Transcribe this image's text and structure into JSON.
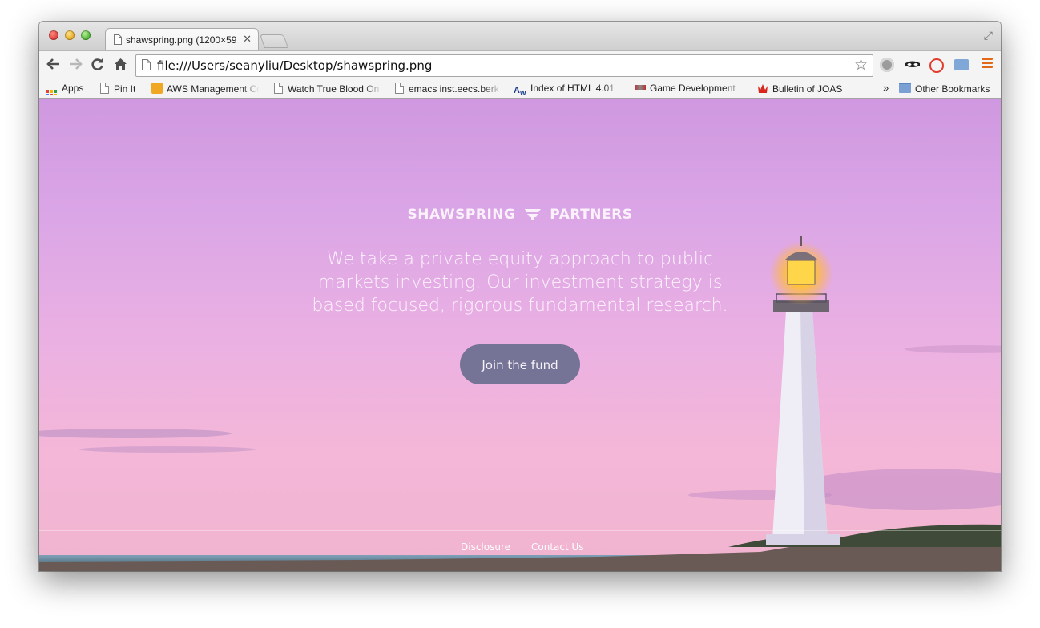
{
  "browser": {
    "tab_title": "shawspring.png (1200×59",
    "url": "file:///Users/seanyliu/Desktop/shawspring.png"
  },
  "bookmarks": {
    "items": [
      {
        "label": "Apps",
        "icon": "apps-grid-icon"
      },
      {
        "label": "Pin It",
        "icon": "document-icon"
      },
      {
        "label": "AWS Management Co",
        "icon": "aws-cube-icon"
      },
      {
        "label": "Watch True Blood On",
        "icon": "document-icon"
      },
      {
        "label": "emacs inst.eecs.berk",
        "icon": "document-icon"
      },
      {
        "label": "Index of HTML 4.01",
        "icon": "w3c-icon"
      },
      {
        "label": "Game Development",
        "icon": "gamedev-icon"
      },
      {
        "label": "Bulletin of JOAS",
        "icon": "crown-icon"
      }
    ],
    "overflow": "»",
    "other": "Other Bookmarks"
  },
  "page": {
    "brand_left": "SHAWSPRING",
    "brand_right": "PARTNERS",
    "tagline": "We take a private equity approach to public markets investing. Our investment strategy is based focused, rigorous fundamental research.",
    "cta": "Join the fund",
    "footer": {
      "disclosure": "Disclosure",
      "contact": "Contact Us"
    }
  },
  "colors": {
    "sky_top": "#cf98e0",
    "sky_bottom": "#f0b4cf",
    "button_bg": "#757396",
    "menu_accent": "#e06a17"
  }
}
